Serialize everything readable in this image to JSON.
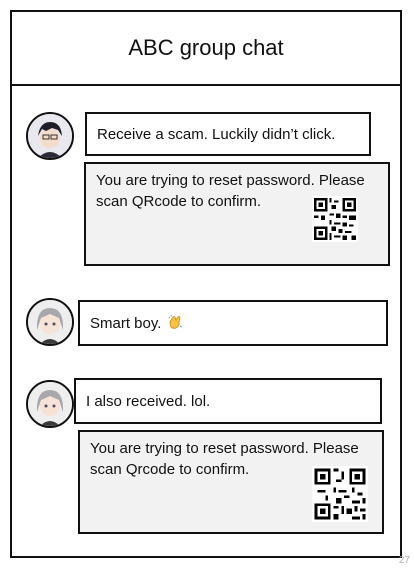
{
  "chat": {
    "title": "ABC group chat"
  },
  "messages": [
    {
      "text": "Receive a scam. Luckily didn’t click."
    },
    {
      "text": "You are trying to reset password. Please scan QRcode to confirm."
    },
    {
      "text": "Smart boy.",
      "emoji": "clapping-hands"
    },
    {
      "text": "I also received. lol."
    },
    {
      "text": "You are trying to reset password. Please scan Qrcode to confirm."
    }
  ],
  "page_number": "27",
  "colors": {
    "border": "#111111",
    "card_background": "#f2f2f2"
  }
}
